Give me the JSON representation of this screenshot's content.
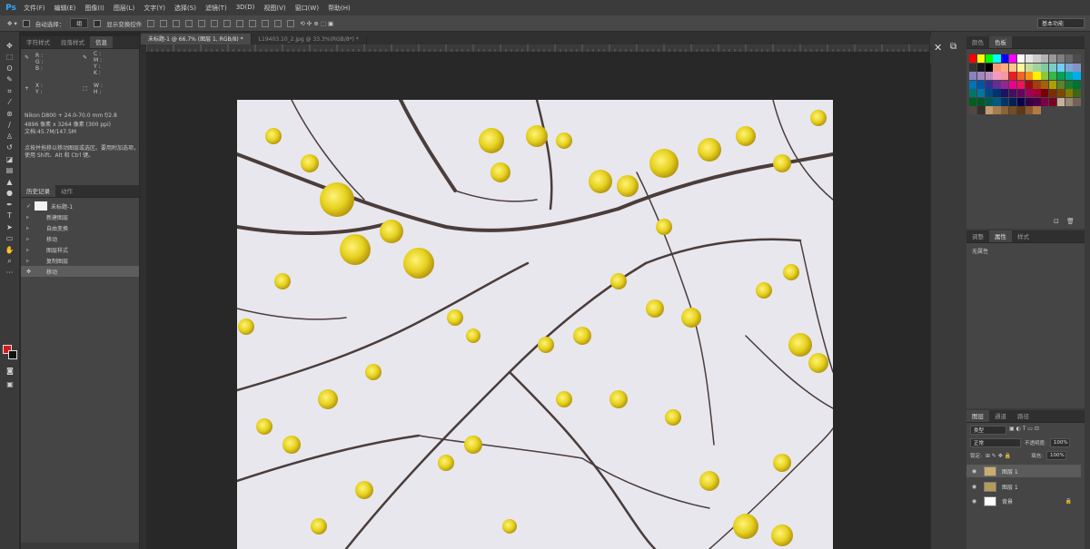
{
  "app": {
    "logo": "Ps"
  },
  "menu": [
    "文件(F)",
    "编辑(E)",
    "图像(I)",
    "图层(L)",
    "文字(Y)",
    "选择(S)",
    "滤镜(T)",
    "3D(D)",
    "视图(V)",
    "窗口(W)",
    "帮助(H)"
  ],
  "options_bar": {
    "auto_select_label": "自动选择：",
    "auto_select_value": "组",
    "transform_label": "显示变换控件",
    "workspace": "基本功能"
  },
  "document_tabs": [
    {
      "label": "未标题-1 @ 66.7% (图层 1, RGB/8) *",
      "active": true
    },
    {
      "label": "L19403.10_2.jpg @ 33.3%(RGB/8*) *",
      "active": false
    }
  ],
  "left_panels": {
    "top_tabs": [
      "字符样式",
      "段落样式",
      "信息"
    ],
    "info": {
      "r": "R :",
      "g": "G :",
      "b": "B :",
      "c": "C :",
      "m": "M :",
      "y": "Y :",
      "k": "K :",
      "x": "X :",
      "yy": "Y :",
      "w": "W :",
      "h": "H :",
      "camera": "Nikon D800 + 24.0-70.0 mm f/2.8",
      "size": "4896 像素 x 3264 像素 (300 ppi)",
      "meta": "文档:45.7M/147.5M",
      "hint1": "点按并拖移以移动图层或选区。要用附加选项，",
      "hint2": "使用 Shift、Alt 和 Ctrl 键。"
    },
    "bottom_tabs": [
      "历史记录",
      "动作"
    ],
    "history": [
      {
        "label": "未标题-1",
        "thumb": true
      },
      {
        "label": "新建图层"
      },
      {
        "label": "自由变换"
      },
      {
        "label": "移动"
      },
      {
        "label": "图层样式"
      },
      {
        "label": "复制图层"
      },
      {
        "label": "移动",
        "selected": true
      }
    ]
  },
  "right_panels": {
    "swatch_tabs": [
      "颜色",
      "色板"
    ],
    "props_tabs": [
      "调整",
      "属性",
      "样式"
    ],
    "props_text": "无属性",
    "layers_tabs": [
      "图层",
      "通道",
      "路径"
    ],
    "kind_filter": "类型",
    "blend_mode": "正常",
    "opacity_label": "不透明度:",
    "opacity_value": "100%",
    "lock_label": "锁定:",
    "fill_label": "填充:",
    "fill_value": "100%",
    "layers": [
      {
        "name": "图层 1",
        "selected": true
      },
      {
        "name": "图层 1"
      },
      {
        "name": "背景",
        "locked": true
      }
    ]
  },
  "colors": {
    "foreground": "#d31a1a",
    "background": "#111111",
    "accent": "#31a8ff"
  }
}
